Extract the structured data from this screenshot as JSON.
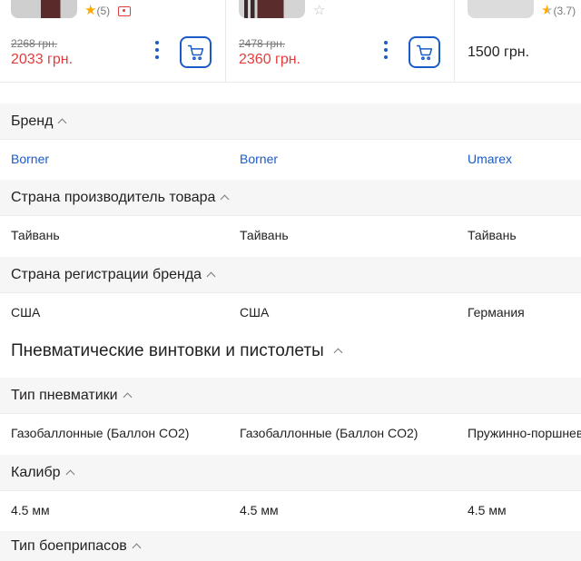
{
  "products": [
    {
      "rating": "(5)",
      "stars": "full",
      "has_promo": true,
      "old_price": "2268 грн.",
      "price": "2033 грн.",
      "has_actions": true
    },
    {
      "rating": "",
      "stars": "empty",
      "has_promo": false,
      "old_price": "2478 грн.",
      "price": "2360 грн.",
      "has_actions": true
    },
    {
      "rating": "(3.7)",
      "stars": "half",
      "has_promo": false,
      "old_price": "",
      "price": "1500 грн.",
      "has_actions": false
    }
  ],
  "groups": {
    "brand": {
      "label": "Бренд",
      "values": [
        "Borner",
        "Borner",
        "Umarex"
      ]
    },
    "country_made": {
      "label": "Страна производитель товара",
      "values": [
        "Тайвань",
        "Тайвань",
        "Тайвань"
      ]
    },
    "country_brand": {
      "label": "Страна регистрации бренда",
      "values": [
        "США",
        "США",
        "Германия"
      ]
    }
  },
  "section": {
    "title": "Пневматические винтовки и пистолеты"
  },
  "specs": {
    "type": {
      "label": "Тип пневматики",
      "values": [
        "Газобаллонные (Баллон CO2)",
        "Газобаллонные (Баллон CO2)",
        "Пружинно-поршнево"
      ]
    },
    "caliber": {
      "label": "Калибр",
      "values": [
        "4.5 мм",
        "4.5 мм",
        "4.5 мм"
      ]
    },
    "ammo": {
      "label": "Тип боеприпасов"
    }
  },
  "colors": {
    "accent": "#1b5bc7",
    "sale": "#e23c3c",
    "star": "#ffa900"
  }
}
